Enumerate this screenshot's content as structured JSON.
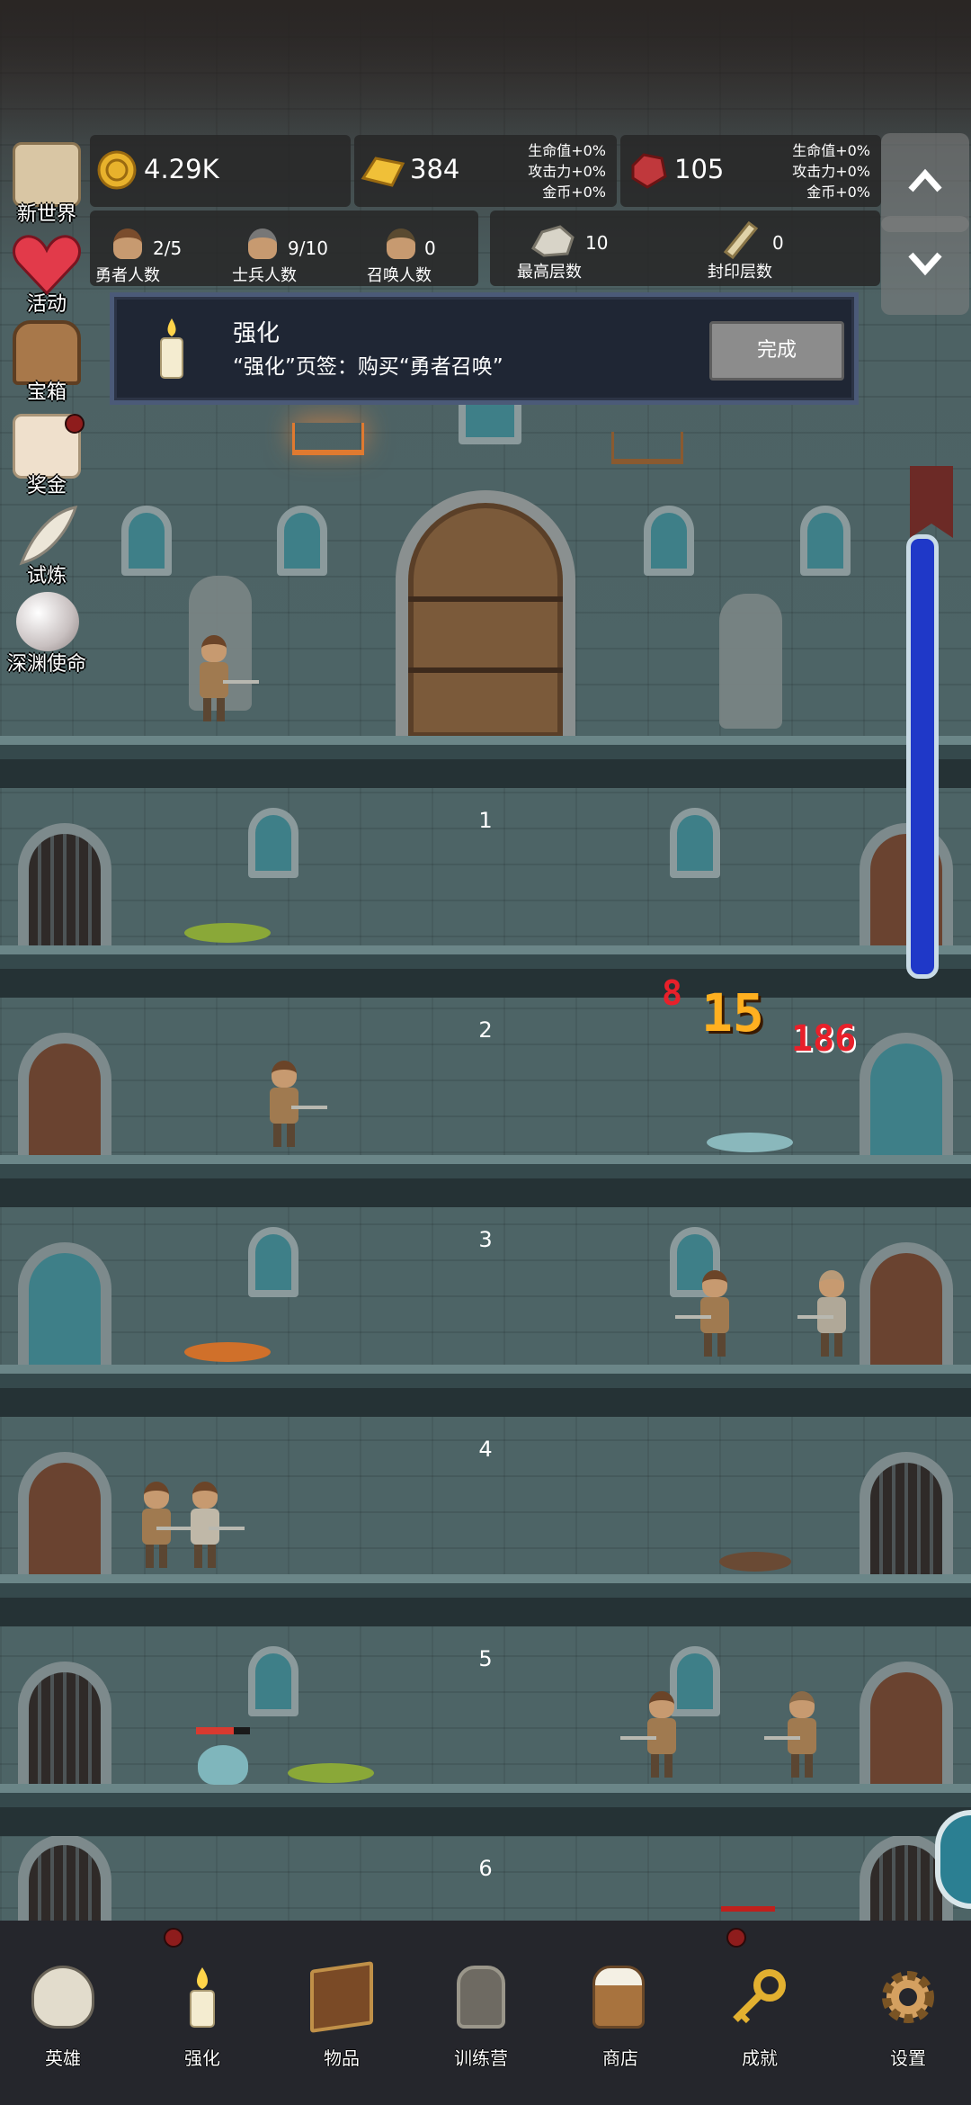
{
  "resources": {
    "gold": {
      "value": "4.29K"
    },
    "gold_bar": {
      "value": "384",
      "bonus_lines": [
        "生命值+0%",
        "攻击力+0%",
        "金币+0%"
      ]
    },
    "ruby": {
      "value": "105",
      "bonus_lines": [
        "生命值+0%",
        "攻击力+0%",
        "金币+0%"
      ]
    }
  },
  "stats": {
    "heroes": {
      "value": "2/5",
      "label": "勇者人数"
    },
    "soldiers": {
      "value": "9/10",
      "label": "士兵人数"
    },
    "summons": {
      "value": "0",
      "label": "召唤人数"
    },
    "highest_floor": {
      "value": "10",
      "label": "最高层数"
    },
    "sealed_floor": {
      "value": "0",
      "label": "封印层数"
    }
  },
  "side_menu": [
    {
      "label": "新世界",
      "icon": "map-scroll-icon"
    },
    {
      "label": "活动",
      "icon": "heart-icon"
    },
    {
      "label": "宝箱",
      "icon": "chest-icon"
    },
    {
      "label": "奖金",
      "icon": "envelope-icon"
    },
    {
      "label": "试炼",
      "icon": "feather-icon"
    },
    {
      "label": "深渊使命",
      "icon": "pearl-icon"
    }
  ],
  "quest": {
    "title": "强化",
    "description": "“强化”页签：购买“勇者召唤”",
    "button": "完成"
  },
  "floors": [
    "1",
    "2",
    "3",
    "4",
    "5",
    "6"
  ],
  "damage_numbers": [
    "8",
    "15",
    "186"
  ],
  "nav": [
    {
      "label": "英雄",
      "icon": "skull-icon"
    },
    {
      "label": "强化",
      "icon": "candle-icon"
    },
    {
      "label": "物品",
      "icon": "book-icon"
    },
    {
      "label": "训练营",
      "icon": "lantern-icon"
    },
    {
      "label": "商店",
      "icon": "beer-mug-icon"
    },
    {
      "label": "成就",
      "icon": "key-icon"
    },
    {
      "label": "设置",
      "icon": "gear-icon"
    }
  ],
  "colors": {
    "panel_bg": "#282828",
    "quest_border": "#4b5a78",
    "scrollbar_fill": "#1f38c8",
    "damage_red": "#e8202a",
    "damage_orange": "#ffb020",
    "notification_dot": "#8e1c1c"
  }
}
